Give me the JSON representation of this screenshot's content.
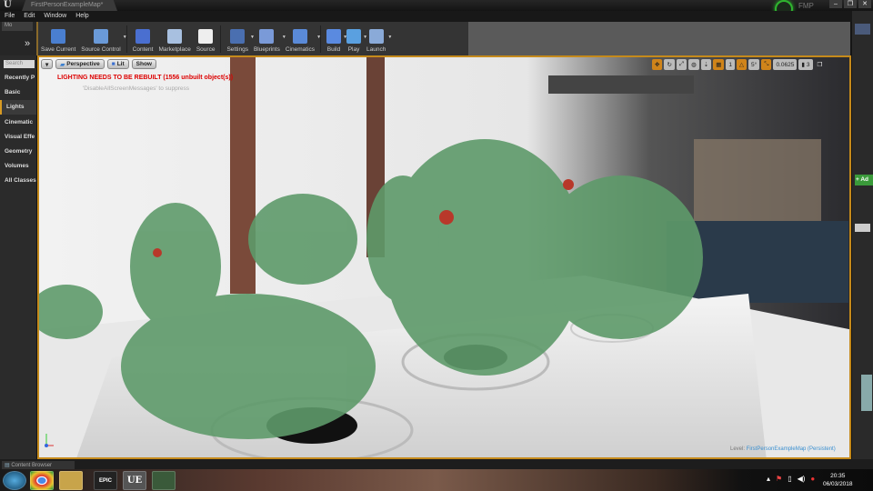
{
  "window": {
    "logo": "U",
    "map_tab": "FirstPersonExampleMap*",
    "badge": "FMP",
    "controls": [
      "–",
      "❐",
      "✕"
    ]
  },
  "menu": [
    "File",
    "Edit",
    "Window",
    "Help"
  ],
  "modes": {
    "tab": "Mo",
    "more": "»"
  },
  "toolbar": [
    {
      "label": "Save Current",
      "icon": "save-icon",
      "color": "#4a7fd0"
    },
    {
      "label": "Source Control",
      "icon": "source-control-icon",
      "color": "#6a9ad8",
      "dropdown": true
    },
    {
      "label": "Content",
      "icon": "content-icon",
      "color": "#4a6fd0"
    },
    {
      "label": "Marketplace",
      "icon": "marketplace-icon",
      "color": "#a8c0e0"
    },
    {
      "label": "Source",
      "icon": "source-icon",
      "color": "#eeeeee"
    },
    {
      "label": "Settings",
      "icon": "settings-icon",
      "color": "#4a6fb0",
      "dropdown": true
    },
    {
      "label": "Blueprints",
      "icon": "blueprints-icon",
      "color": "#7a9ad8",
      "dropdown": true
    },
    {
      "label": "Cinematics",
      "icon": "cinematics-icon",
      "color": "#5a8ad8",
      "dropdown": true
    },
    {
      "label": "Build",
      "icon": "build-icon",
      "color": "#5a8ae0",
      "dropdown": true
    },
    {
      "label": "Play",
      "icon": "play-icon",
      "color": "#5aa0e0",
      "dropdown": true
    },
    {
      "label": "Launch",
      "icon": "launch-icon",
      "color": "#8aaad8",
      "dropdown": true
    }
  ],
  "placement": {
    "search_placeholder": "Search",
    "items": [
      "Recently P",
      "Basic",
      "Lights",
      "Cinematic",
      "Visual Effe",
      "Geometry",
      "Volumes",
      "All Classes"
    ],
    "selected": 2
  },
  "viewport": {
    "buttons": [
      "Perspective",
      "Lit",
      "Show"
    ],
    "warning": "LIGHTING NEEDS TO BE REBUILT (1556 unbuilt object(s))",
    "suppress": "'DisableAllScreenMessages' to suppress",
    "grid_snap": "1",
    "rotation_snap": "5°",
    "scale_snap": "0.0625",
    "camera_speed": "3",
    "level_prefix": "Level:",
    "level_name": "FirstPersonExampleMap (Persistent)",
    "accent": "#c58a1b"
  },
  "right_panel": {
    "add_label": "+ Ad"
  },
  "content_browser": {
    "tab": "Content Browser"
  },
  "taskbar": {
    "apps": [
      "start",
      "chrome",
      "explorer",
      "EPIC",
      "UE",
      "monitor"
    ],
    "time": "20:35",
    "date": "06/03/2018"
  }
}
